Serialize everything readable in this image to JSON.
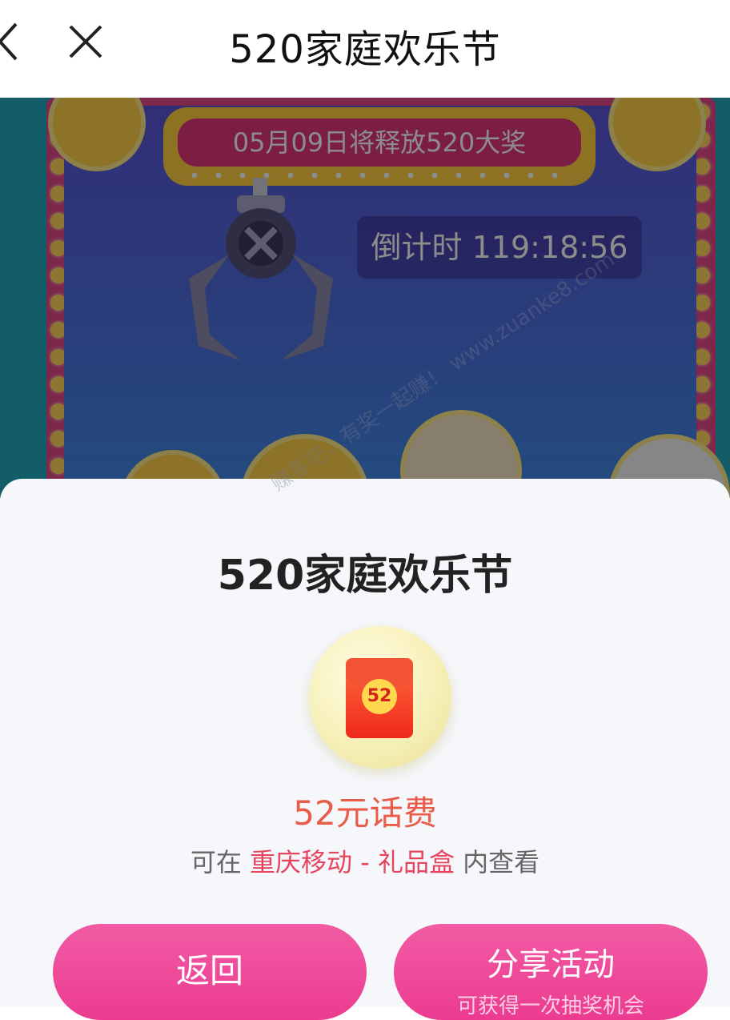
{
  "navbar": {
    "title": "520家庭欢乐节",
    "back_icon": "chevron-left-icon",
    "close_icon": "close-icon"
  },
  "game": {
    "banner_text": "05月09日将释放520大奖",
    "countdown_text": "倒计时 119:18:56"
  },
  "dialog": {
    "title": "520家庭欢乐节",
    "prize_badge": "52",
    "prize_name": "52元话费",
    "hint_prefix": "可在",
    "hint_location": "重庆移动 - 礼品盒",
    "hint_suffix": "内查看",
    "back_button": "返回",
    "share_button": "分享活动",
    "share_subtext": "可获得一次抽奖机会"
  },
  "watermark": "赚客吧，有奖一起赚！ www.zuanke8.com",
  "colors": {
    "accent_pink": "#ec3b90",
    "prize_red": "#ea5c4a",
    "hint_highlight": "#e5455e"
  }
}
